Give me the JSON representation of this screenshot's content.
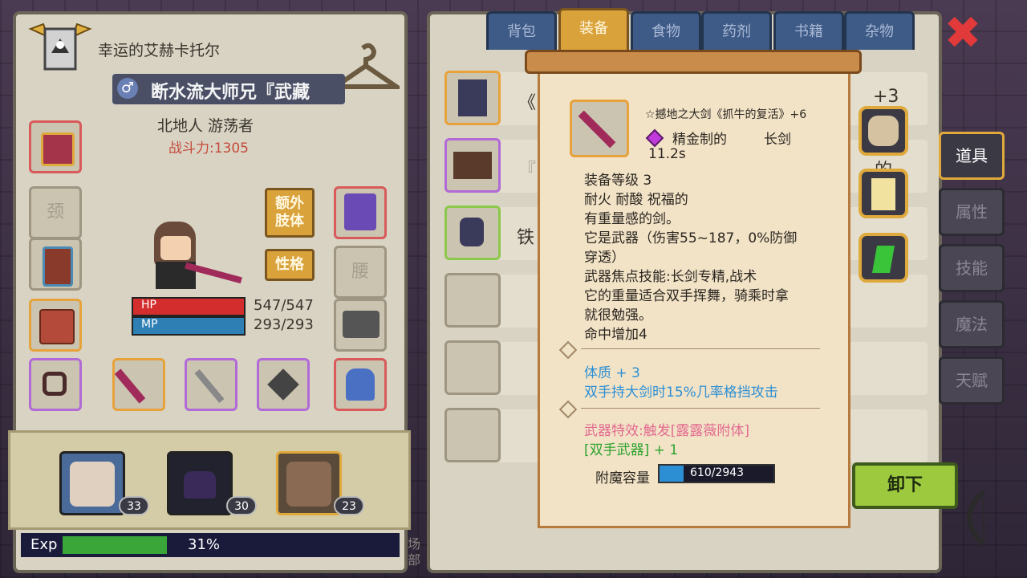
{
  "character": {
    "name": "幸运的艾赫卡托尔",
    "title": "断水流大师兄『武藏",
    "race_class": "北地人 游荡者",
    "power": "战斗力:1305",
    "hp_label": "HP",
    "mp_label": "MP",
    "hp": "547/547",
    "mp": "293/293",
    "extra_limb_btn": "额外\n肢体",
    "personality_btn": "性格",
    "neck_slot": "颈",
    "waist_slot": "腰"
  },
  "party": [
    {
      "level": "33"
    },
    {
      "level": "30"
    },
    {
      "level": "23"
    }
  ],
  "exp": {
    "label": "Exp",
    "percent_text": "31%",
    "fill": 0.31
  },
  "tabs": [
    {
      "label": "背包"
    },
    {
      "label": "装备",
      "active": true
    },
    {
      "label": "食物"
    },
    {
      "label": "药剂"
    },
    {
      "label": "书籍"
    },
    {
      "label": "杂物"
    }
  ],
  "side_tabs": [
    {
      "label": "道具",
      "active": true
    },
    {
      "label": "属性"
    },
    {
      "label": "技能"
    },
    {
      "label": "魔法"
    },
    {
      "label": "天赋"
    }
  ],
  "list_partial": {
    "row1": "《",
    "row1_right": "+3",
    "row2": "『",
    "row2_right": "的",
    "row3": "铁"
  },
  "tooltip": {
    "item_name": "☆撼地之大剑《抓牛的复活》+6",
    "material": "精金制的",
    "type": "长剑",
    "speed": "11.2s",
    "lines": [
      "装备等级 3",
      "耐火  耐酸  祝福的",
      "有重量感的剑。",
      "它是武器（伤害55~187，0%防御",
      "穿透）",
      "武器焦点技能:长剑专精,战术",
      "它的重量适合双手挥舞，骑乘时拿",
      "就很勉强。",
      "命中增加4"
    ],
    "blue_lines": [
      "体质 + 3",
      "双手持大剑时15%几率格挡攻击"
    ],
    "pink_line": "武器特效:触发[露露薇附体]",
    "green_line": "[双手武器] + 1",
    "enchant_label": "附魔容量",
    "enchant_value": "610/2943",
    "enchant_fill": 0.207
  },
  "buttons": {
    "unequip": "卸下",
    "close": "✖"
  },
  "icons": {
    "crest": "guild-crest-icon",
    "hanger": "hanger-icon",
    "gender": "male-icon"
  },
  "colors": {
    "accent": "#d9a23a",
    "hp": "#d42d2d",
    "mp": "#2d7fb4",
    "exp": "#3aa63a",
    "panel": "#d8d3c3"
  },
  "bottom_text": "场\n部"
}
